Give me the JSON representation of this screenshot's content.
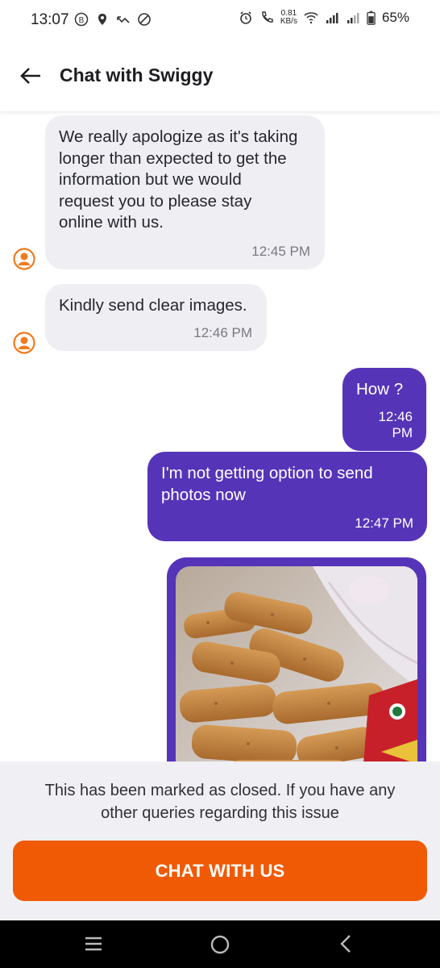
{
  "status_bar": {
    "time": "13:07",
    "net_speed_value": "0.81",
    "net_speed_unit": "KB/s",
    "battery": "65%"
  },
  "header": {
    "title": "Chat with Swiggy",
    "back_icon": "arrow-left-icon"
  },
  "messages": [
    {
      "direction": "incoming",
      "lines": [
        "We really apologize as it's taking",
        "longer than expected to get the",
        "information but we would",
        "request you to please stay",
        "online with us."
      ],
      "time": "12:45 PM"
    },
    {
      "direction": "incoming",
      "lines": [
        "Kindly send clear images."
      ],
      "time": "12:46 PM"
    },
    {
      "direction": "outgoing",
      "lines": [
        "How ?"
      ],
      "time": "12:46 PM"
    },
    {
      "direction": "outgoing",
      "lines": [
        "I'm not getting option to send",
        "photos now"
      ],
      "time": "12:47 PM"
    },
    {
      "direction": "outgoing",
      "type": "image",
      "image": "fried-food-photo"
    }
  ],
  "closed_panel": {
    "message_line1": "This has been marked as closed. If you have any",
    "message_line2": "other queries regarding this issue",
    "button_label": "CHAT WITH US"
  },
  "colors": {
    "accent_purple": "#5634b8",
    "cta_orange": "#f05a05",
    "incoming_bubble": "#efeff3",
    "avatar_orange": "#f07a1c"
  }
}
